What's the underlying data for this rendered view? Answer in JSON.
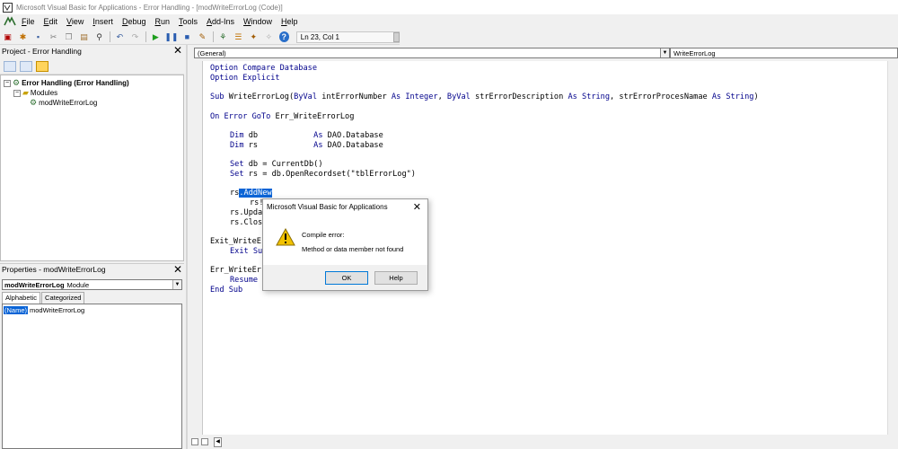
{
  "window": {
    "title": "Microsoft Visual Basic for Applications - Error Handling - [modWriteErrorLog (Code)]"
  },
  "menu": [
    {
      "pre": "",
      "u": "F",
      "post": "ile"
    },
    {
      "pre": "",
      "u": "E",
      "post": "dit"
    },
    {
      "pre": "",
      "u": "V",
      "post": "iew"
    },
    {
      "pre": "",
      "u": "I",
      "post": "nsert"
    },
    {
      "pre": "",
      "u": "D",
      "post": "ebug"
    },
    {
      "pre": "",
      "u": "R",
      "post": "un"
    },
    {
      "pre": "",
      "u": "T",
      "post": "ools"
    },
    {
      "pre": "",
      "u": "A",
      "post": "dd-Ins"
    },
    {
      "pre": "",
      "u": "W",
      "post": "indow"
    },
    {
      "pre": "",
      "u": "H",
      "post": "elp"
    }
  ],
  "toolbar": {
    "position": "Ln 23, Col 1"
  },
  "project": {
    "title": "Project - Error Handling",
    "root": "Error Handling (Error Handling)",
    "folder": "Modules",
    "module": "modWriteErrorLog"
  },
  "properties": {
    "title": "Properties - modWriteErrorLog",
    "object_name": "modWriteErrorLog",
    "object_type": "Module",
    "tab_alphabetic": "Alphabetic",
    "tab_categorized": "Categorized",
    "prop_name": "(Name)",
    "prop_value": "modWriteErrorLog"
  },
  "code_header": {
    "object_combo": "(General)",
    "proc_combo": "WriteErrorLog"
  },
  "code": {
    "l1_kw": "Option Compare Database",
    "l2_kw": "Option Explicit",
    "l3_kw1": "Sub",
    "l3_t1": " WriteErrorLog(",
    "l3_kw2": "ByVal",
    "l3_t2": " intErrorNumber ",
    "l3_kw3": "As Integer",
    "l3_t3": ", ",
    "l3_kw4": "ByVal",
    "l3_t4": " strErrorDescription ",
    "l3_kw5": "As String",
    "l3_t5": ", strErrorProcesNamae ",
    "l3_kw6": "As String",
    "l3_t6": ")",
    "l4_kw": "On Error GoTo",
    "l4_t": " Err_WriteErrorLog",
    "l5_kw": "Dim",
    "l5_t1": " db            ",
    "l5_kw2": "As",
    "l5_t2": " DAO.Database",
    "l6_kw": "Dim",
    "l6_t1": " rs            ",
    "l6_kw2": "As",
    "l6_t2": " DAO.Database",
    "l7_kw": "Set",
    "l7_t": " db = CurrentDb()",
    "l8_kw": "Set",
    "l8_t": " rs = db.OpenRecordset(\"tblErrorLog\")",
    "l9_t": "rs",
    "l9_hl": ".AddNew",
    "l10_t": "rs!",
    "l11_t": "rs.Upda",
    "l12_t": "rs.Clos",
    "l13_t": "Exit_WriteEr",
    "l14_kw": "Exit Sub",
    "l15_t": "Err_WriteEr",
    "l16_kw": "Resume",
    "l17_kw": "End Sub"
  },
  "dialog": {
    "title": "Microsoft Visual Basic for Applications",
    "line1": "Compile error:",
    "line2": "Method or data member not found",
    "ok": "OK",
    "help": "Help"
  }
}
